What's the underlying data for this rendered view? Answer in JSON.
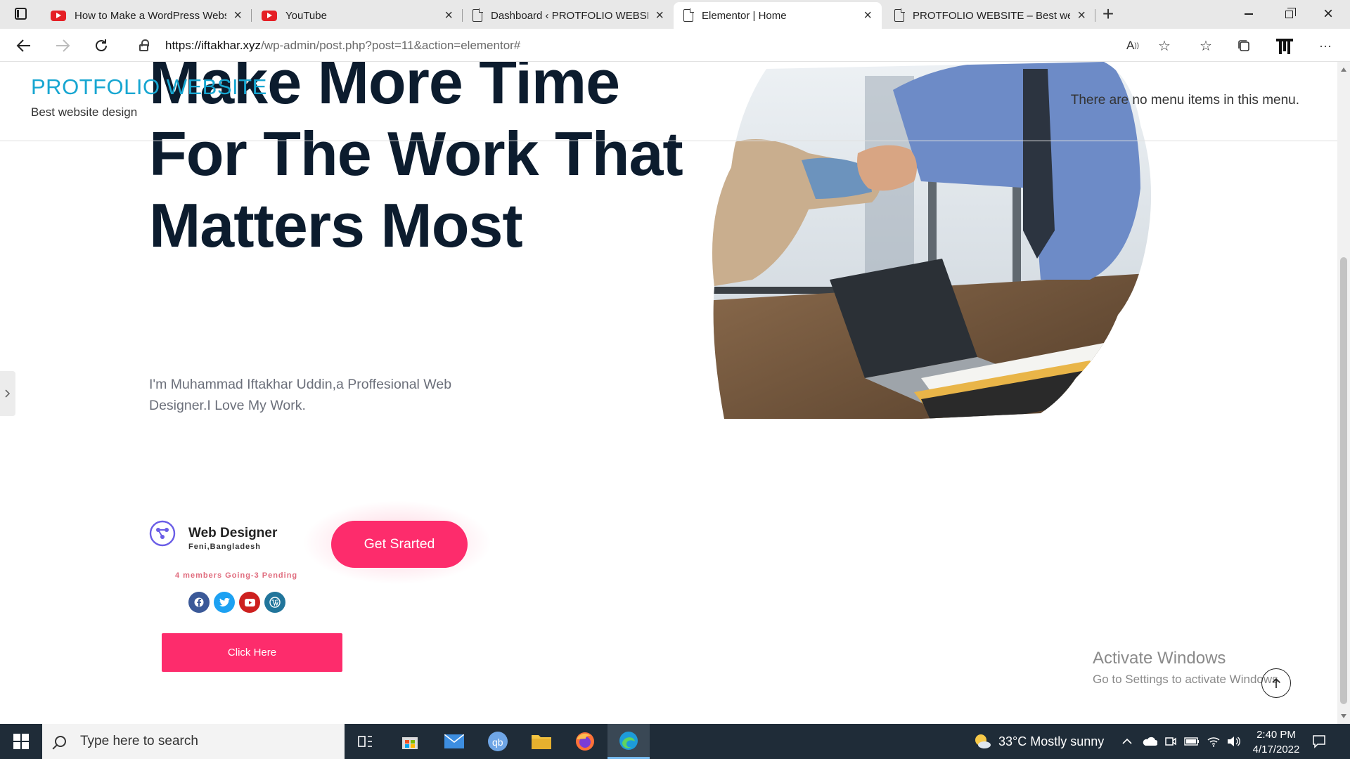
{
  "browser": {
    "tabs": [
      {
        "title": "How to Make a WordPress Webs",
        "icon": "youtube-icon",
        "active": false
      },
      {
        "title": "YouTube",
        "icon": "youtube-icon",
        "active": false
      },
      {
        "title": "Dashboard ‹ PROTFOLIO WEBSIT",
        "icon": "document-icon",
        "active": false
      },
      {
        "title": "Elementor | Home",
        "icon": "document-icon",
        "active": true
      },
      {
        "title": "PROTFOLIO WEBSITE – Best web",
        "icon": "document-icon",
        "active": false
      }
    ],
    "url_domain": "https://iftakhar.xyz",
    "url_path": "/wp-admin/post.php?post=11&action=elementor#"
  },
  "site": {
    "title": "PROTFOLIO WEBSITE",
    "tagline": "Best website design",
    "menu_note": "There are no menu items in this menu."
  },
  "hero": {
    "headline": "Make More Time For The Work That Matters Most",
    "bio": "I'm Muhammad Iftakhar Uddin,a Proffesional Web Designer.I Love My Work.",
    "cta_label": "Get Srarted"
  },
  "profile": {
    "role": "Web Designer",
    "location": "Feni,Bangladesh",
    "members": "4 members Going-3 Pending",
    "social": [
      "facebook-icon",
      "twitter-icon",
      "youtube-icon",
      "wordpress-icon"
    ],
    "button_label": "Click Here"
  },
  "watermark": {
    "title": "Activate Windows",
    "subtitle": "Go to Settings to activate Windows."
  },
  "taskbar": {
    "search_placeholder": "Type here to search",
    "weather": "33°C  Mostly sunny",
    "time": "2:40 PM",
    "date": "4/17/2022"
  },
  "colors": {
    "accent_pink": "#fd2c6c",
    "site_title_blue": "#17a6d1",
    "headline_dark": "#0c1c2e",
    "taskbar": "#1f2c38"
  }
}
